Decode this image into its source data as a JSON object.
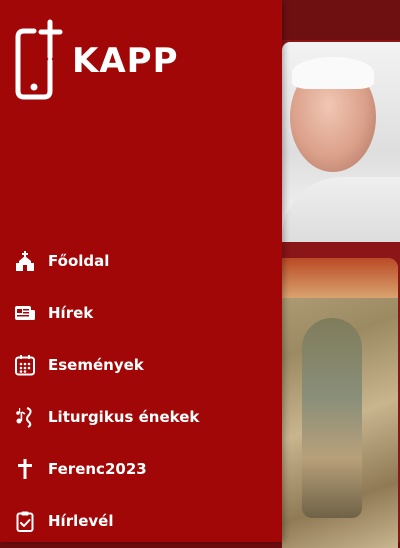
{
  "app": {
    "title": "KAPP"
  },
  "drawer": {
    "items": [
      {
        "label": "Főoldal",
        "icon": "church-icon"
      },
      {
        "label": "Hírek",
        "icon": "news-icon"
      },
      {
        "label": "Események",
        "icon": "calendar-icon"
      },
      {
        "label": "Liturgikus énekek",
        "icon": "music-notes-icon"
      },
      {
        "label": "Ferenc2023",
        "icon": "cross-icon"
      },
      {
        "label": "Hírlevél",
        "icon": "clipboard-check-icon"
      }
    ]
  },
  "colors": {
    "drawer_bg": "#a10707",
    "text": "#ffffff",
    "background": "#8a1618"
  }
}
